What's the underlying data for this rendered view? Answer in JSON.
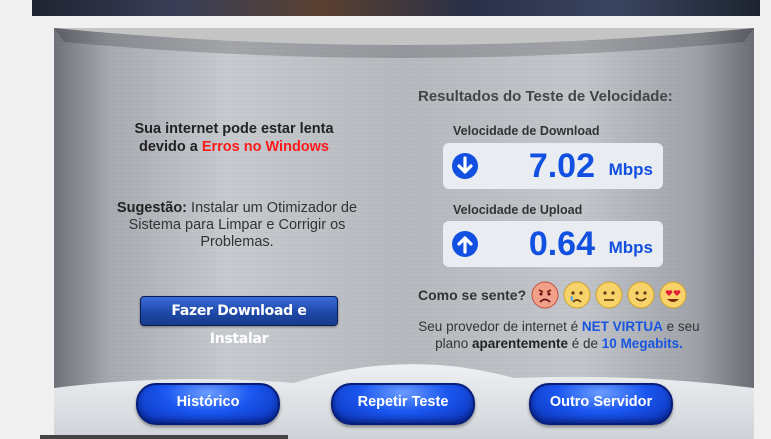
{
  "warning": {
    "line1": "Sua internet pode estar lenta",
    "line2_prefix": "devido a ",
    "line2_highlight": "Erros no Windows"
  },
  "suggestion": {
    "label": "Sugestão:",
    "text": " Instalar um Otimizador de Sistema para Limpar e Corrigir os Problemas."
  },
  "download_button_label": "Fazer Download e Instalar",
  "results": {
    "title": "Resultados do Teste de Velocidade:",
    "download": {
      "label": "Velocidade de Download",
      "value": "7.02",
      "unit": "Mbps",
      "icon": "arrow-down-circle-icon"
    },
    "upload": {
      "label": "Velocidade de Upload",
      "value": "0.64",
      "unit": "Mbps",
      "icon": "arrow-up-circle-icon"
    }
  },
  "feedback": {
    "question": "Como se sente?",
    "emojis": [
      "angry-face-icon",
      "crying-face-icon",
      "neutral-face-icon",
      "smiling-face-icon",
      "heart-eyes-face-icon"
    ]
  },
  "provider": {
    "prefix": "Seu provedor de internet é ",
    "name": "NET VIRTUA",
    "middle1": " e seu plano ",
    "bold": "aparentemente",
    "middle2": " é de ",
    "plan": "10 Megabits."
  },
  "buttons": {
    "history": "Histórico",
    "repeat": "Repetir Teste",
    "other_server": "Outro Servidor"
  },
  "colors": {
    "accent_blue": "#1150e0",
    "warning_red": "#ff1a1a",
    "button_blue": "#1a56f0"
  }
}
